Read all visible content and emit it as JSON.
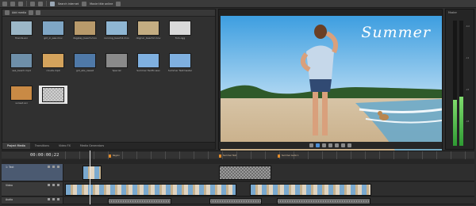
{
  "toolbar": {
    "items": [
      {
        "icon": "new-file-icon"
      },
      {
        "icon": "open-folder-icon"
      },
      {
        "icon": "save-icon"
      },
      {
        "icon": "undo-icon"
      },
      {
        "icon": "redo-icon"
      }
    ],
    "search_label": "Search internet",
    "web_label": "Movie title online"
  },
  "media_pool": {
    "header_label": "Add media",
    "items": [
      {
        "caption": "friends.avi",
        "color": "#9cb7c7"
      },
      {
        "caption": "girl_in_sea.mov",
        "color": "#7fa6c5"
      },
      {
        "caption": "dogplay_beach.mov",
        "color": "#b89a6b"
      },
      {
        "caption": "running_beach2.mov",
        "color": "#8fb6d3"
      },
      {
        "caption": "dogrun_beach2.mov",
        "color": "#c4ad82"
      },
      {
        "caption": "fnm.ogg",
        "color": "#d9d9d9"
      },
      {
        "caption": "sea_beach.mp4",
        "color": "#6e8fa9"
      },
      {
        "caption": "clouds.mp4",
        "color": "#d4a35c"
      },
      {
        "caption": "girl_ebs_sweet",
        "color": "#4f79a8"
      },
      {
        "caption": "Special",
        "color": "#8a8a8a"
      },
      {
        "caption": "Summer Textfx.wav",
        "color": "#7fb0e0"
      },
      {
        "caption": "Summer Textmaster",
        "color": "#7fb0e0"
      },
      {
        "caption": "sunset.avi",
        "color": "#c98a45"
      },
      {
        "caption": "",
        "color": "#a8a8a8"
      }
    ],
    "tabs": [
      "Project Media",
      "Transitions",
      "Video FX",
      "Media Generators"
    ],
    "active_tab": 0
  },
  "preview": {
    "overlay_text": "Summer"
  },
  "meter": {
    "label": "Master",
    "levels": [
      0.37,
      0.39
    ],
    "ticks": [
      "-6.0",
      "-12",
      "-24",
      "-48"
    ]
  },
  "timeline": {
    "timecode": "00:00:00;22",
    "markers": [
      {
        "label": "Region"
      },
      {
        "label": "Summer Text"
      },
      {
        "label": "Summer Audio 1"
      }
    ],
    "tracks": [
      {
        "name": "1: Text",
        "selected": true
      },
      {
        "name": "Video",
        "selected": false
      },
      {
        "name": "Audio",
        "selected": false
      }
    ]
  }
}
